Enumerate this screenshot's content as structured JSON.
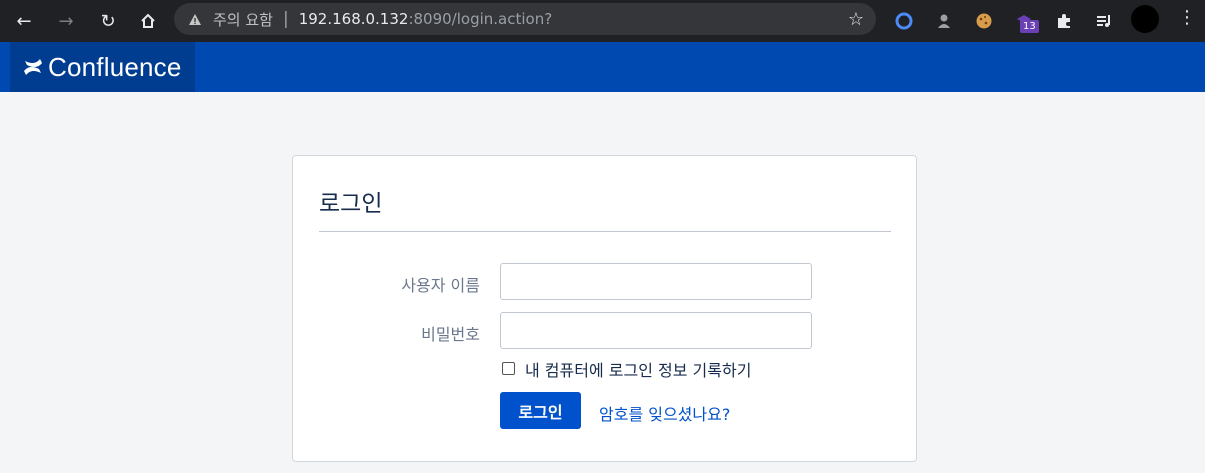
{
  "browser": {
    "security_warning": "주의 요함",
    "url_host": "192.168.0.132",
    "url_rest": ":8090/login.action?",
    "extension_badge": "13"
  },
  "header": {
    "app_name": "Confluence",
    "brand_color": "#0049b0"
  },
  "login": {
    "title": "로그인",
    "username_label": "사용자 이름",
    "username_value": "",
    "password_label": "비밀번호",
    "password_value": "",
    "remember_label": "내 컴퓨터에 로그인 정보 기록하기",
    "remember_checked": false,
    "submit_label": "로그인",
    "forgot_link": "암호를 잊으셨나요?"
  }
}
